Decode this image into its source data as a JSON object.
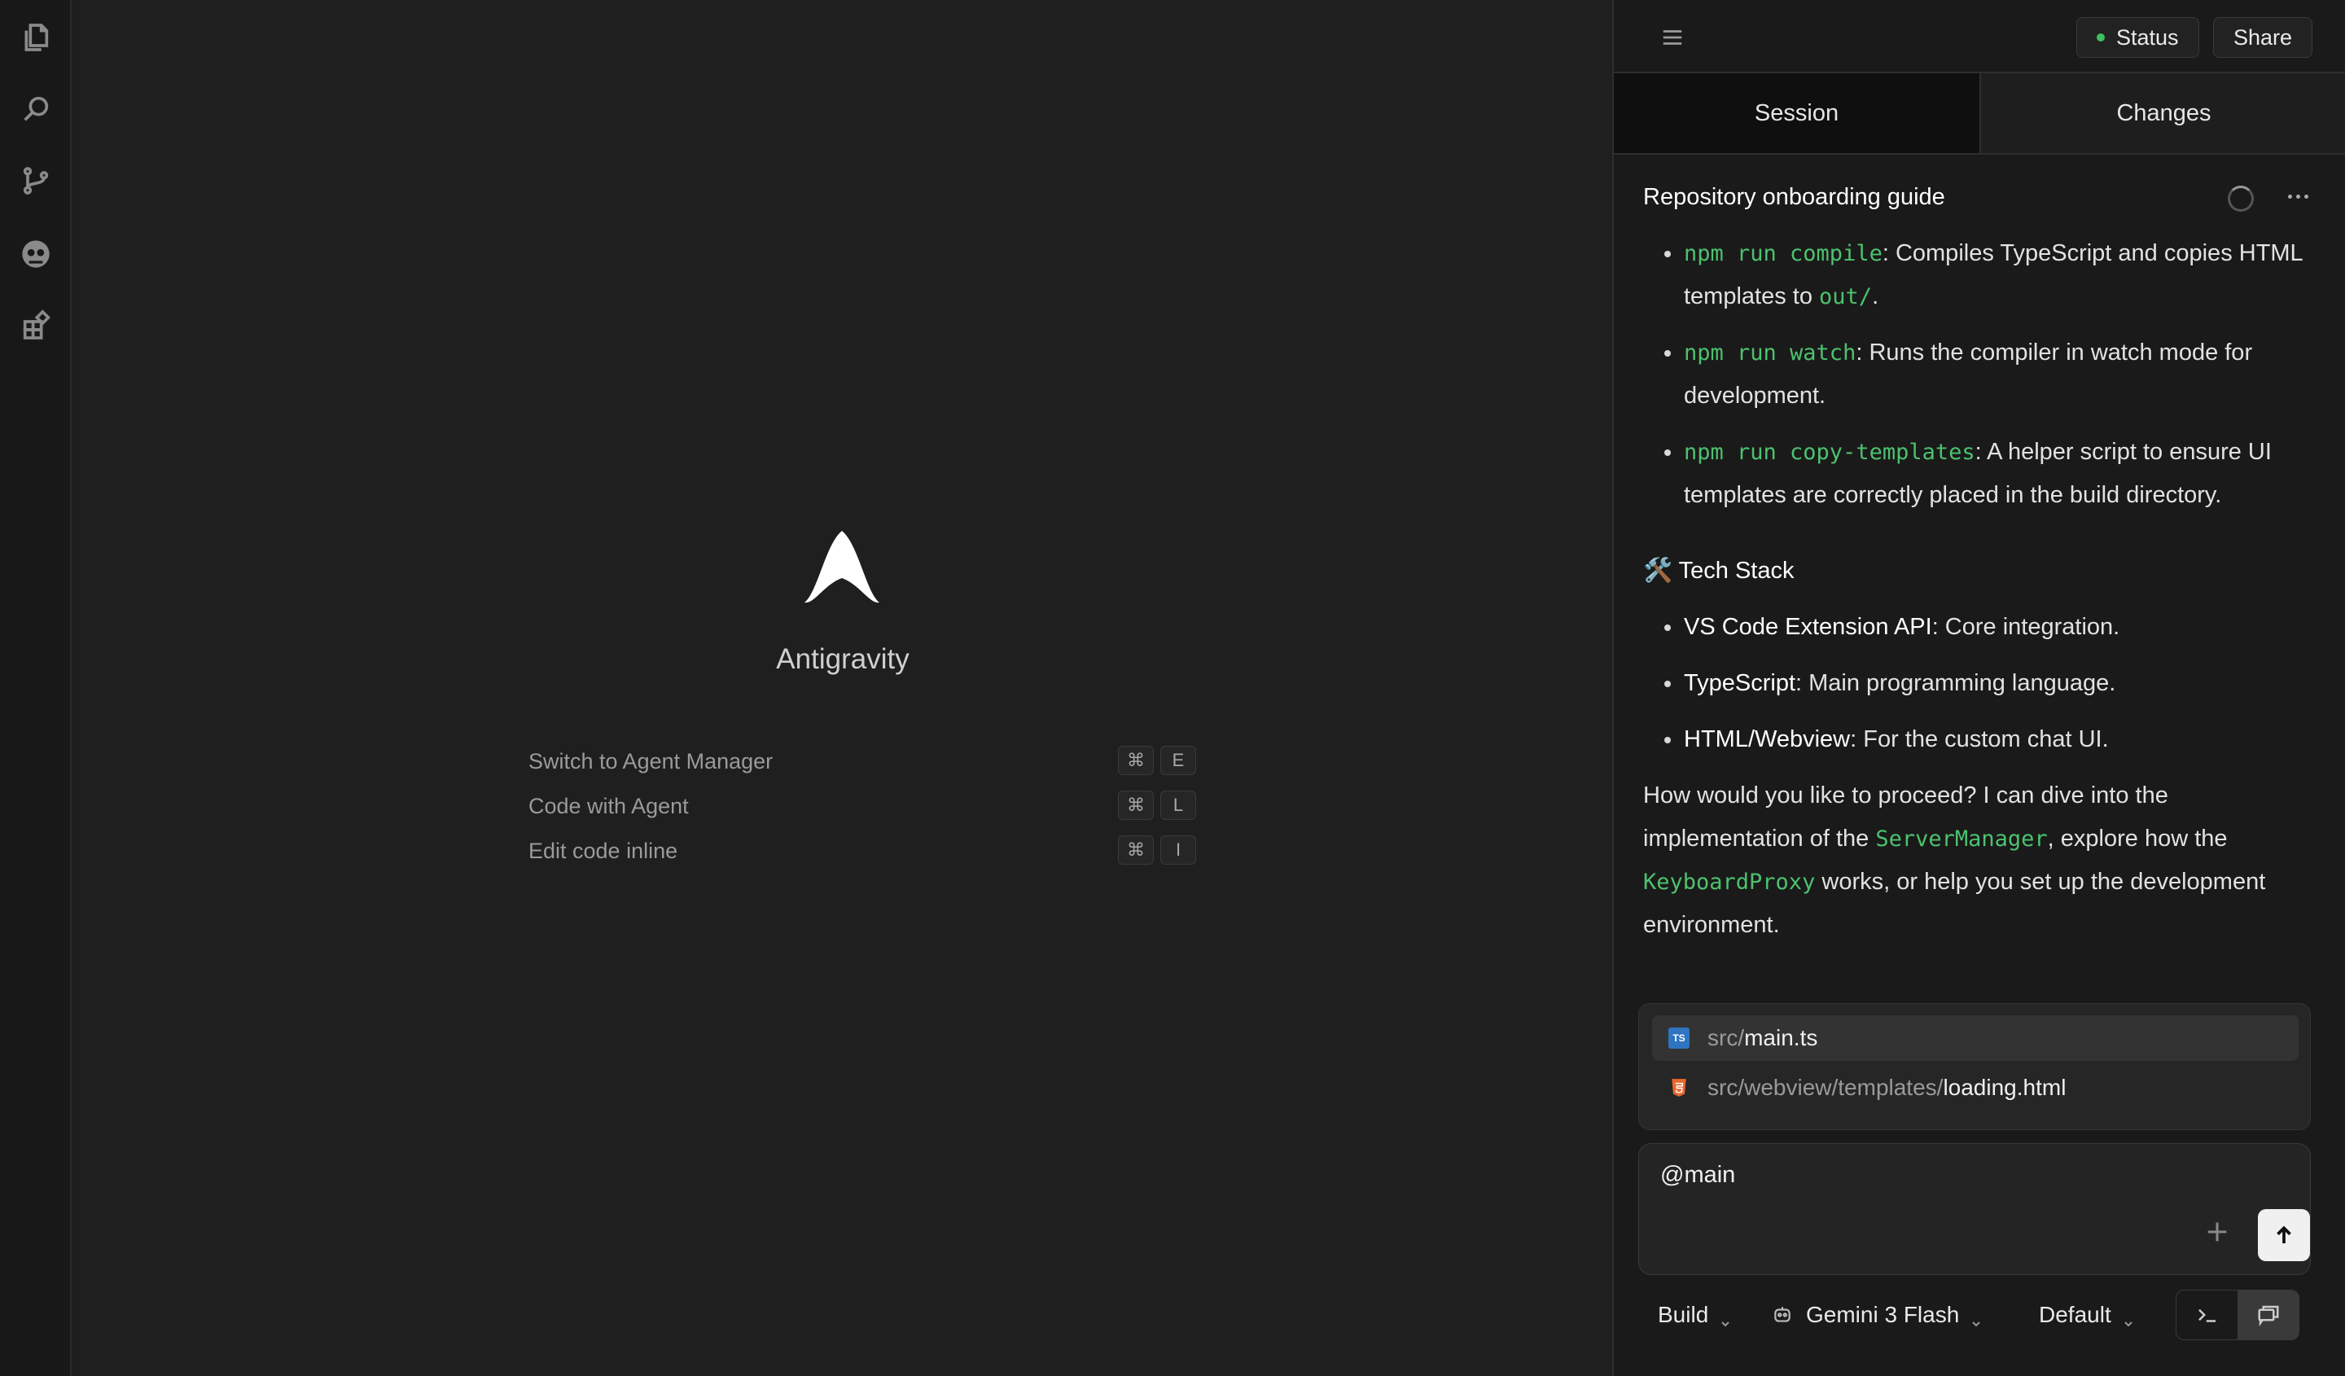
{
  "activity_bar": {
    "icons": [
      "files-icon",
      "search-icon",
      "source-control-icon",
      "agent-icon",
      "extensions-icon"
    ]
  },
  "welcome": {
    "app_name": "Antigravity",
    "shortcuts": [
      {
        "label": "Switch to Agent Manager",
        "keys": [
          "⌘",
          "E"
        ]
      },
      {
        "label": "Code with Agent",
        "keys": [
          "⌘",
          "L"
        ]
      },
      {
        "label": "Edit code inline",
        "keys": [
          "⌘",
          "I"
        ]
      }
    ]
  },
  "panel": {
    "status_label": "Status",
    "status_color": "#3fbf5f",
    "share_label": "Share",
    "tabs": [
      {
        "label": "Session",
        "active": true
      },
      {
        "label": "Changes",
        "active": false
      }
    ],
    "conversation": {
      "title": "Repository onboarding guide",
      "scripts": [
        {
          "cmd": "npm run compile",
          "text": ": Compiles TypeScript and copies HTML templates to ",
          "code2": "out/",
          "end": "."
        },
        {
          "cmd": "npm run watch",
          "text": ": Runs the compiler in watch mode for development."
        },
        {
          "cmd": "npm run copy-templates",
          "text": ": A helper script to ensure UI templates are correctly placed in the build directory."
        }
      ],
      "tech_stack_heading": "🛠️ Tech Stack",
      "tech_stack": [
        {
          "name": "VS Code Extension API",
          "desc": ": Core integration."
        },
        {
          "name": "TypeScript",
          "desc": ": Main programming language."
        },
        {
          "name": "HTML/Webview",
          "desc": ": For the custom chat UI."
        }
      ],
      "closing": {
        "p1": "How would you like to proceed? I can dive into the implementation of the ",
        "c1": "ServerManager",
        "p2": ", explore how the ",
        "c2": "KeyboardProxy",
        "p3": " works, or help you set up the development environment."
      }
    },
    "mention_suggestions": [
      {
        "dir": "src/",
        "file": "main.ts",
        "type": "ts",
        "selected": true
      },
      {
        "dir": "src/webview/templates/",
        "file": "loading.html",
        "type": "html",
        "selected": false
      }
    ],
    "input": {
      "value": "@main"
    },
    "bottom_bar": {
      "mode": "Build",
      "model": "Gemini 3 Flash",
      "profile": "Default"
    }
  }
}
